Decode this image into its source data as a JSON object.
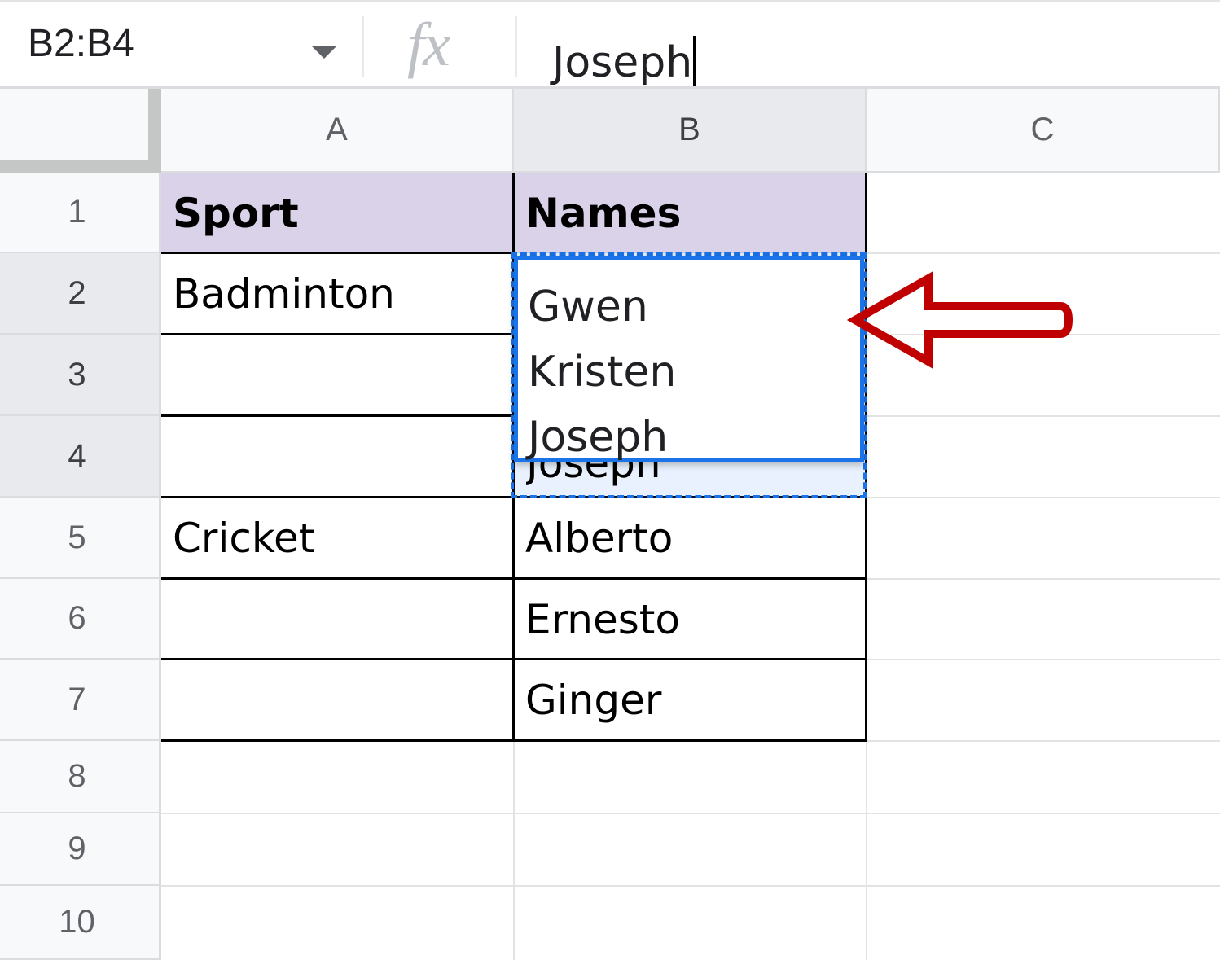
{
  "formula_bar": {
    "name_box": "B2:B4",
    "fx_label": "fx",
    "value": "Joseph"
  },
  "columns": [
    "A",
    "B",
    "C"
  ],
  "rows": [
    "1",
    "2",
    "3",
    "4",
    "5",
    "6",
    "7",
    "8",
    "9",
    "10"
  ],
  "cells": {
    "A1": "Sport",
    "B1": "Names",
    "A2": "Badminton",
    "A5": "Cricket",
    "B5": "Alberto",
    "B6": "Ernesto",
    "B7": "Ginger"
  },
  "editor": {
    "lines": [
      "Gwen",
      "Kristen",
      "Joseph"
    ],
    "underlying_text": "Joseph"
  },
  "colors": {
    "selection": "#1a73e8",
    "header_fill": "#d9d2e9",
    "annotation_arrow": "#c00000"
  },
  "icons": {
    "name_box_dropdown": "chevron-down-icon",
    "formula": "fx-icon",
    "annotation": "arrow-left-icon"
  }
}
